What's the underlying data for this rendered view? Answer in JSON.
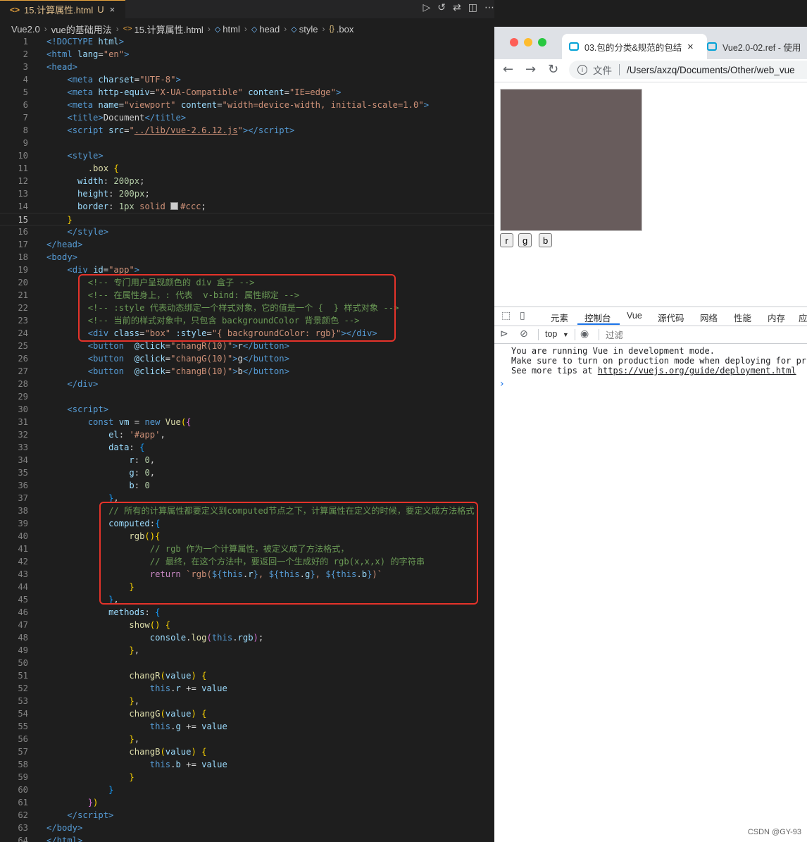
{
  "editor": {
    "tab": {
      "icon": "<>",
      "filename": "15.计算属性.html",
      "status": "U",
      "close": "×"
    },
    "breadcrumb": [
      "Vue2.0",
      "vue的基础用法",
      "15.计算属性.html",
      "html",
      "head",
      "style",
      ".box"
    ],
    "current_line": 15,
    "lines": [
      {
        "n": "1",
        "html": "<span class=\"t\">&lt;!DOCTYPE</span> <span class=\"a\">html</span><span class=\"t\">&gt;</span>"
      },
      {
        "n": "2",
        "html": "<span class=\"t\">&lt;html</span> <span class=\"a\">lang</span>=<span class=\"s\">\"en\"</span><span class=\"t\">&gt;</span>"
      },
      {
        "n": "3",
        "html": "<span class=\"t\">&lt;head&gt;</span>"
      },
      {
        "n": "4",
        "html": "    <span class=\"t\">&lt;meta</span> <span class=\"a\">charset</span>=<span class=\"s\">\"UTF-8\"</span><span class=\"t\">&gt;</span>"
      },
      {
        "n": "5",
        "html": "    <span class=\"t\">&lt;meta</span> <span class=\"a\">http-equiv</span>=<span class=\"s\">\"X-UA-Compatible\"</span> <span class=\"a\">content</span>=<span class=\"s\">\"IE=edge\"</span><span class=\"t\">&gt;</span>"
      },
      {
        "n": "6",
        "html": "    <span class=\"t\">&lt;meta</span> <span class=\"a\">name</span>=<span class=\"s\">\"viewport\"</span> <span class=\"a\">content</span>=<span class=\"s\">\"width=device-width, initial-scale=1.0\"</span><span class=\"t\">&gt;</span>"
      },
      {
        "n": "7",
        "html": "    <span class=\"t\">&lt;title&gt;</span>Document<span class=\"t\">&lt;/title&gt;</span>"
      },
      {
        "n": "8",
        "html": "    <span class=\"t\">&lt;script</span> <span class=\"a\">src</span>=<span class=\"s\">\"<span class=\"u\">../lib/vue-2.6.12.js</span>\"</span><span class=\"t\">&gt;&lt;/script&gt;</span>"
      },
      {
        "n": "9",
        "html": ""
      },
      {
        "n": "10",
        "html": "    <span class=\"t\">&lt;style&gt;</span>"
      },
      {
        "n": "11",
        "html": "        <span class=\"f\">.box</span> <span class=\"br\">{</span>"
      },
      {
        "n": "12",
        "html": "      <span class=\"a\">width</span>: <span class=\"n\">200px</span>;"
      },
      {
        "n": "13",
        "html": "      <span class=\"a\">height</span>: <span class=\"n\">200px</span>;"
      },
      {
        "n": "14",
        "html": "      <span class=\"a\">border</span>: <span class=\"n\">1px</span> <span class=\"s\">solid</span> <span class=\"sw\"></span><span class=\"s\">#ccc</span>;"
      },
      {
        "n": "15",
        "html": "    <span class=\"br\">}</span>"
      },
      {
        "n": "16",
        "html": "    <span class=\"t\">&lt;/style&gt;</span>"
      },
      {
        "n": "17",
        "html": "<span class=\"t\">&lt;/head&gt;</span>"
      },
      {
        "n": "18",
        "html": "<span class=\"t\">&lt;body&gt;</span>"
      },
      {
        "n": "19",
        "html": "    <span class=\"t\">&lt;div</span> <span class=\"a\">id</span>=<span class=\"s\">\"app\"</span><span class=\"t\">&gt;</span>"
      },
      {
        "n": "20",
        "html": "        <span class=\"c\">&lt;!-- 专门用户呈现颜色的 div 盒子 --&gt;</span>"
      },
      {
        "n": "21",
        "html": "        <span class=\"c\">&lt;!-- 在属性身上，: 代表  v-bind: 属性绑定 --&gt;</span>"
      },
      {
        "n": "22",
        "html": "        <span class=\"c\">&lt;!-- :style 代表动态绑定一个样式对象，它的值是一个 {  } 样式对象 --&gt;</span>"
      },
      {
        "n": "23",
        "html": "        <span class=\"c\">&lt;!-- 当前的样式对象中，只包含 backgroundColor 背景颜色 --&gt;</span>"
      },
      {
        "n": "24",
        "html": "        <span class=\"t\">&lt;div</span> <span class=\"a\">class</span>=<span class=\"s\">\"box\"</span> <span class=\"a\">:style</span>=<span class=\"s\">\"{ backgroundColor: rgb}\"</span><span class=\"t\">&gt;&lt;/div&gt;</span>"
      },
      {
        "n": "25",
        "html": "        <span class=\"t\">&lt;button</span>  <span class=\"a\">@click</span>=<span class=\"s\">\"changR(10)\"</span><span class=\"t\">&gt;</span>r<span class=\"t\">&lt;/button&gt;</span>"
      },
      {
        "n": "26",
        "html": "        <span class=\"t\">&lt;button</span>  <span class=\"a\">@click</span>=<span class=\"s\">\"changG(10)\"</span><span class=\"t\">&gt;</span>g<span class=\"t\">&lt;/button&gt;</span>"
      },
      {
        "n": "27",
        "html": "        <span class=\"t\">&lt;button</span>  <span class=\"a\">@click</span>=<span class=\"s\">\"changB(10)\"</span><span class=\"t\">&gt;</span>b<span class=\"t\">&lt;/button&gt;</span>"
      },
      {
        "n": "28",
        "html": "    <span class=\"t\">&lt;/div&gt;</span>"
      },
      {
        "n": "29",
        "html": ""
      },
      {
        "n": "30",
        "html": "    <span class=\"t\">&lt;script&gt;</span>"
      },
      {
        "n": "31",
        "html": "        <span class=\"kw\">const</span> <span class=\"v\">vm</span> = <span class=\"kw\">new</span> <span class=\"f\">Vue</span><span class=\"br\">(</span><span class=\"br2\">{</span>"
      },
      {
        "n": "32",
        "html": "            <span class=\"v\">el</span>: <span class=\"s\">'#app'</span>,"
      },
      {
        "n": "33",
        "html": "            <span class=\"v\">data</span>: <span class=\"br3\">{</span>"
      },
      {
        "n": "34",
        "html": "                <span class=\"v\">r</span>: <span class=\"n\">0</span>,"
      },
      {
        "n": "35",
        "html": "                <span class=\"v\">g</span>: <span class=\"n\">0</span>,"
      },
      {
        "n": "36",
        "html": "                <span class=\"v\">b</span>: <span class=\"n\">0</span>"
      },
      {
        "n": "37",
        "html": "            <span class=\"br3\">}</span>,"
      },
      {
        "n": "38",
        "html": "            <span class=\"c\">// 所有的计算属性都要定义到computed节点之下，计算属性在定义的时候，要定义成方法格式</span>"
      },
      {
        "n": "39",
        "html": "            <span class=\"v\">computed</span>:<span class=\"br3\">{</span>"
      },
      {
        "n": "40",
        "html": "                <span class=\"f\">rgb</span><span class=\"br\">()</span><span class=\"br\">{</span>"
      },
      {
        "n": "41",
        "html": "                    <span class=\"c\">// rgb 作为一个计算属性，被定义成了方法格式，</span>"
      },
      {
        "n": "42",
        "html": "                    <span class=\"c\">// 最终，在这个方法中，要返回一个生成好的 rgb(x,x,x) 的字符串</span>"
      },
      {
        "n": "43",
        "html": "                    <span class=\"k\">return</span> <span class=\"s\">`rgb(</span><span class=\"kw\">${</span><span class=\"kw\">this</span>.<span class=\"v\">r</span><span class=\"kw\">}</span><span class=\"s\">, </span><span class=\"kw\">${</span><span class=\"kw\">this</span>.<span class=\"v\">g</span><span class=\"kw\">}</span><span class=\"s\">, </span><span class=\"kw\">${</span><span class=\"kw\">this</span>.<span class=\"v\">b</span><span class=\"kw\">}</span><span class=\"s\">)`</span>"
      },
      {
        "n": "44",
        "html": "                <span class=\"br\">}</span>"
      },
      {
        "n": "45",
        "html": "            <span class=\"br3\">}</span>,"
      },
      {
        "n": "46",
        "html": "            <span class=\"v\">methods</span>: <span class=\"br3\">{</span>"
      },
      {
        "n": "47",
        "html": "                <span class=\"f\">show</span><span class=\"br\">()</span> <span class=\"br\">{</span>"
      },
      {
        "n": "48",
        "html": "                    <span class=\"v\">console</span>.<span class=\"f\">log</span><span class=\"br2\">(</span><span class=\"kw\">this</span>.<span class=\"v\">rgb</span><span class=\"br2\">)</span>;"
      },
      {
        "n": "49",
        "html": "                <span class=\"br\">}</span>,"
      },
      {
        "n": "50",
        "html": ""
      },
      {
        "n": "51",
        "html": "                <span class=\"f\">changR</span><span class=\"br\">(</span><span class=\"v\">value</span><span class=\"br\">)</span> <span class=\"br\">{</span>"
      },
      {
        "n": "52",
        "html": "                    <span class=\"kw\">this</span>.<span class=\"v\">r</span> += <span class=\"v\">value</span>"
      },
      {
        "n": "53",
        "html": "                <span class=\"br\">}</span>,"
      },
      {
        "n": "54",
        "html": "                <span class=\"f\">changG</span><span class=\"br\">(</span><span class=\"v\">value</span><span class=\"br\">)</span> <span class=\"br\">{</span>"
      },
      {
        "n": "55",
        "html": "                    <span class=\"kw\">this</span>.<span class=\"v\">g</span> += <span class=\"v\">value</span>"
      },
      {
        "n": "56",
        "html": "                <span class=\"br\">}</span>,"
      },
      {
        "n": "57",
        "html": "                <span class=\"f\">changB</span><span class=\"br\">(</span><span class=\"v\">value</span><span class=\"br\">)</span> <span class=\"br\">{</span>"
      },
      {
        "n": "58",
        "html": "                    <span class=\"kw\">this</span>.<span class=\"v\">b</span> += <span class=\"v\">value</span>"
      },
      {
        "n": "59",
        "html": "                <span class=\"br\">}</span>"
      },
      {
        "n": "60",
        "html": "            <span class=\"br3\">}</span>"
      },
      {
        "n": "61",
        "html": "        <span class=\"br2\">}</span><span class=\"br\">)</span>"
      },
      {
        "n": "62",
        "html": "    <span class=\"t\">&lt;/script&gt;</span>"
      },
      {
        "n": "63",
        "html": "<span class=\"t\">&lt;/body&gt;</span>"
      },
      {
        "n": "64",
        "html": "<span class=\"t\">&lt;/html&gt;</span>"
      }
    ]
  },
  "browser": {
    "tabs": [
      {
        "title": "03.包的分类&规范的包结",
        "close": "×"
      },
      {
        "title": "Vue2.0-02.ref - 使用"
      }
    ],
    "address_label": "文件",
    "address_path": "/Users/axzq/Documents/Other/web_vue",
    "box_color": "#685c5c",
    "buttons": [
      "r",
      "g",
      "b"
    ]
  },
  "devtools": {
    "tabs": [
      "元素",
      "控制台",
      "Vue",
      "源代码",
      "网络",
      "性能",
      "内存",
      "应"
    ],
    "active_tab": "控制台",
    "context": "top",
    "filter_placeholder": "过滤",
    "console_lines": [
      "You are running Vue in development mode.",
      "Make sure to turn on production mode when deploying for pr",
      "See more tips at "
    ],
    "console_link": "https://vuejs.org/guide/deployment.html",
    "prompt": "›"
  },
  "watermark": "CSDN @GY-93"
}
